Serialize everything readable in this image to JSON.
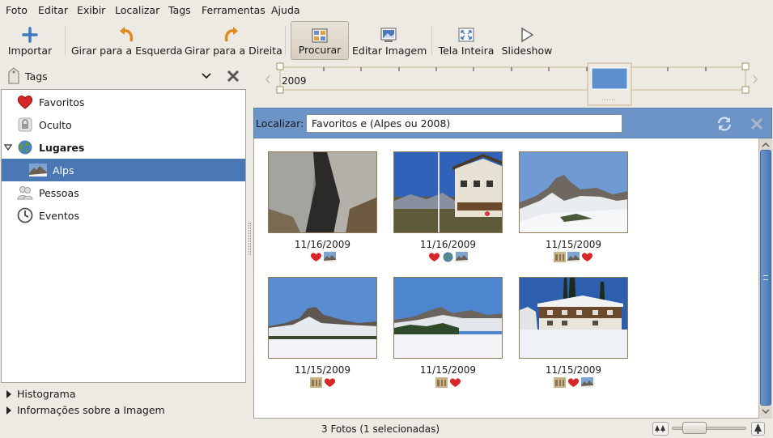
{
  "menu": [
    "Foto",
    "Editar",
    "Exibir",
    "Localizar",
    "Tags",
    "Ferramentas",
    "Ajuda"
  ],
  "toolbar": {
    "import": "Importar",
    "rotate_left": "Girar para a Esquerda",
    "rotate_right": "Girar para a Direita",
    "search": "Procurar",
    "edit_image": "Editar Imagem",
    "fullscreen": "Tela Inteira",
    "slideshow": "Slideshow"
  },
  "tags_panel": {
    "selector": "Tags",
    "items": [
      {
        "label": "Favoritos",
        "icon": "heart-icon"
      },
      {
        "label": "Oculto",
        "icon": "lock-icon"
      },
      {
        "label": "Lugares",
        "icon": "globe-icon"
      },
      {
        "label": "Alps",
        "icon": "mountain-thumbnail-icon",
        "selected": true
      },
      {
        "label": "Pessoas",
        "icon": "people-icon"
      },
      {
        "label": "Eventos",
        "icon": "clock-icon"
      }
    ],
    "expanders": [
      "Histograma",
      "Informações sobre a Imagem"
    ]
  },
  "timeline": {
    "year_label": "2009"
  },
  "find": {
    "label": "Localizar:",
    "query": "Favoritos e (Alpes ou 2008)"
  },
  "photos": [
    {
      "date": "11/16/2009",
      "tags": [
        "heart",
        "mountain"
      ]
    },
    {
      "date": "11/16/2009",
      "tags": [
        "heart",
        "globe",
        "mountain"
      ]
    },
    {
      "date": "11/15/2009",
      "tags": [
        "building",
        "mountain",
        "heart"
      ]
    },
    {
      "date": "11/15/2009",
      "tags": [
        "building",
        "heart"
      ]
    },
    {
      "date": "11/15/2009",
      "tags": [
        "building",
        "heart"
      ]
    },
    {
      "date": "11/15/2009",
      "tags": [
        "building",
        "heart",
        "mountain"
      ]
    }
  ],
  "status": {
    "text": "3 Fotos (1 selecionadas)"
  },
  "colors": {
    "accent": "#4a78b4",
    "findbar": "#6d94c7",
    "heart": "#d62828",
    "background": "#ede9e3"
  }
}
